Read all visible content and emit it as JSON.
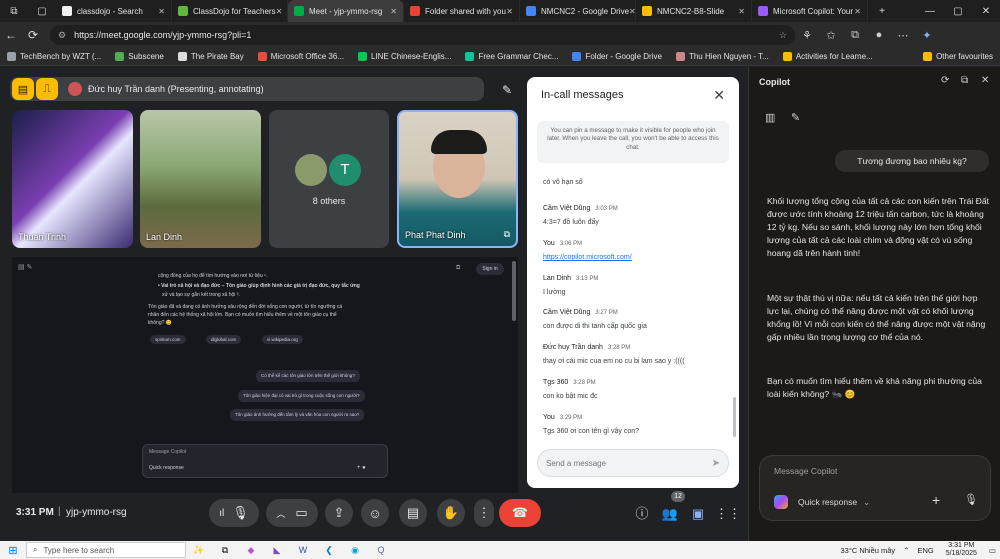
{
  "browser": {
    "tabs": [
      {
        "title": "classdojo - Search",
        "color": "#f0f0f0"
      },
      {
        "title": "ClassDojo for Teachers",
        "color": "#5fb93a"
      },
      {
        "title": "Meet - yjp-ymmo-rsg",
        "color": "#00ac47",
        "active": true
      },
      {
        "title": "Folder shared with you",
        "color": "#ea4335"
      },
      {
        "title": "NMCNC2 - Google Drive",
        "color": "#4285f4"
      },
      {
        "title": "NMCNC2-B8-Slide",
        "color": "#fbbc04"
      },
      {
        "title": "Microsoft Copilot: Your",
        "color": "#9b59f5"
      }
    ],
    "url": "https://meet.google.com/yjp-ymmo-rsg?pli=1",
    "bookmarks": [
      {
        "label": "TechBench by WZT (...",
        "color": "#9aa0a6"
      },
      {
        "label": "Subscene",
        "color": "#4caf50"
      },
      {
        "label": "The Pirate Bay",
        "color": "#ddd"
      },
      {
        "label": "Microsoft Office 36...",
        "color": "#e74c3c"
      },
      {
        "label": "LINE Chinese-Englis...",
        "color": "#06c755"
      },
      {
        "label": "Free Grammar Chec...",
        "color": "#15c39a"
      },
      {
        "label": "Folder - Google Drive",
        "color": "#4285f4"
      },
      {
        "label": "Thu Hien Nguyen - T...",
        "color": "#c88"
      },
      {
        "label": "Activities for Learne...",
        "color": "#fbbc04"
      }
    ],
    "other_favourites": "Other favourites"
  },
  "meet": {
    "presenting": "Đức huy Trần danh (Presenting, annotating)",
    "tiles": [
      {
        "name": "Thuan Trinh"
      },
      {
        "name": "Lan Dinh"
      },
      {
        "name": "8 others",
        "avatar_letter": "T"
      },
      {
        "name": "Phat Phat Dinh"
      }
    ],
    "clock": "3:31 PM",
    "meeting_code": "yjp-ymmo-rsg",
    "participants_badge": "12"
  },
  "shared_screen": {
    "lines": [
      "cộng đồng của họ để tìm hướng vào nơi từ liệu ¹.",
      "• Vai trò xã hội và đạo đức – Tôn giáo giúp định hình các giá trị đạo đức, quy tắc ứng",
      "xử và tạo sự gắn kết trong xã hội ³.",
      "Tôn giáo đã và đang có ảnh hưởng sâu rộng đến đời sống con người, từ tín ngưỡng cá",
      "nhân đến các hệ thống xã hội lớn. Bạn có muốn tìm hiểu thêm về một tôn giáo cụ thể",
      "không? 😊"
    ],
    "sources": [
      "spiritum.com",
      "dlglobal.com",
      "vi.wikipedia.org"
    ],
    "questions": [
      "Có thể kể các tôn giáo lớn trên thế giới không?",
      "Tôn giáo hiện đại có vai trò gì trong cuộc sống con người?",
      "Tôn giáo ảnh hưởng đến tâm lý và văn hóa con người ra sao?"
    ],
    "message_placeholder": "Message Copilot",
    "quick_response": "Quick response",
    "sign_in": "Sign in"
  },
  "incall": {
    "title": "In-call messages",
    "pin_note": "You can pin a message to make it visible for people who join later. When you leave the call, you won't be able to access this chat.",
    "messages": [
      {
        "who": "",
        "time": "",
        "text": "có vô hạn số"
      },
      {
        "who": "Cầm Việt Dũng",
        "time": "3:03 PM",
        "text": "4:3=7 đồ luôn đấy"
      },
      {
        "who": "You",
        "time": "3:06 PM",
        "text": "https://copilot.microsoft.com/",
        "link": true
      },
      {
        "who": "Lan Dinh",
        "time": "3:13 PM",
        "text": "I lường"
      },
      {
        "who": "Cầm Việt Dũng",
        "time": "3:27 PM",
        "text": "con được di thi tanh cấp quốc gia"
      },
      {
        "who": "Đức huy Trần danh",
        "time": "3:28 PM",
        "text": "thay ơi cái mic cua em no cu bi lam sao y :(((("
      },
      {
        "who": "Tgs 360",
        "time": "3:28 PM",
        "text": "con ko bật mic đc"
      },
      {
        "who": "You",
        "time": "3:29 PM",
        "text": "Tgs 360 ơi  con tên gì vậy con?"
      }
    ],
    "send_placeholder": "Send a message"
  },
  "copilot": {
    "title": "Copilot",
    "user_question": "Tương đương bao nhiêu kg?",
    "answer_p1": "Khối lượng tổng cộng của tất cả các con kiến trên Trái Đất được ước tính khoảng 12 triệu tấn carbon, tức là khoảng 12 tỷ kg. Nếu so sánh, khối lượng này lớn hơn tổng khối lượng của tất cả các loài chim và động vật có vú sống hoang dã trên hành tinh!",
    "answer_p2": "Một sự thật thú vị nữa: nếu tất cả kiến trên thế giới hợp lực lại, chúng có thể nâng được một vật có khối lượng khổng lồ! Vì mỗi con kiến có thể nâng được một vật nặng gấp nhiều lần trọng lượng cơ thể của nó.",
    "answer_p3": "Bạn có muốn tìm hiểu thêm về khả năng phi thường của loài kiến không? 🐜 😊",
    "input_placeholder": "Message Copilot",
    "quick_response": "Quick response"
  },
  "taskbar": {
    "search": "Type here to search",
    "weather": "33°C  Nhiều mây",
    "lang": "ENG",
    "time": "3:31 PM",
    "date": "5/18/2025"
  }
}
